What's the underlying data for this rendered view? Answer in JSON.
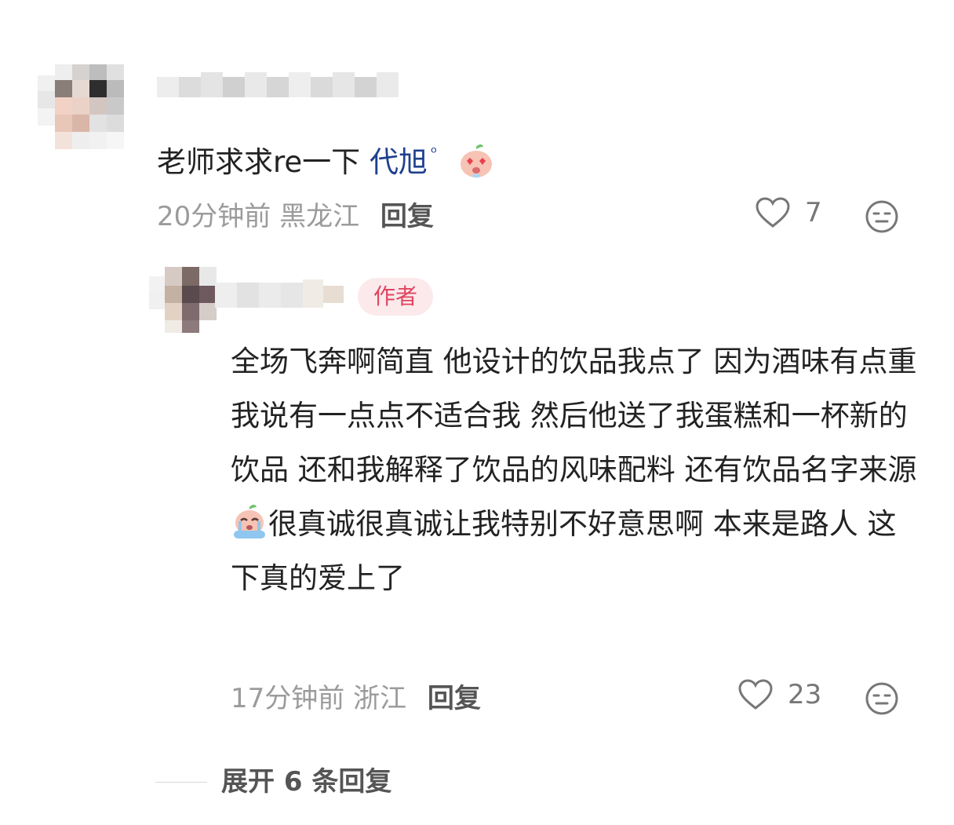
{
  "comment": {
    "text": "老师求求re一下",
    "mention": "代旭",
    "mention_suffix": "ᵒ",
    "emoji_icon": "heart-eyes-peach-face",
    "time": "20分钟前",
    "location": "黑龙江",
    "reply_label": "回复",
    "like_count": "7"
  },
  "reply": {
    "author_badge": "作者",
    "text_part1": "全场飞奔啊简直 他设计的饮品我点了 因为酒味有点重我说有一点点不适合我 然后他送了我蛋糕和一杯新的饮品 还和我解释了饮品的风味配料 还有饮品名字来源",
    "emoji_icon": "crying-peach-face",
    "text_part2": "很真诚很真诚让我特别不好意思啊 本来是路人 这下真的爱上了",
    "time": "17分钟前",
    "location": "浙江",
    "reply_label": "回复",
    "like_count": "23"
  },
  "expand": {
    "label": "展开 6 条回复"
  },
  "colors": {
    "mention": "#1f3f8f",
    "meta": "#9b9b9b",
    "author_badge_bg": "#fbe9ec",
    "author_badge_text": "#e0455f"
  }
}
